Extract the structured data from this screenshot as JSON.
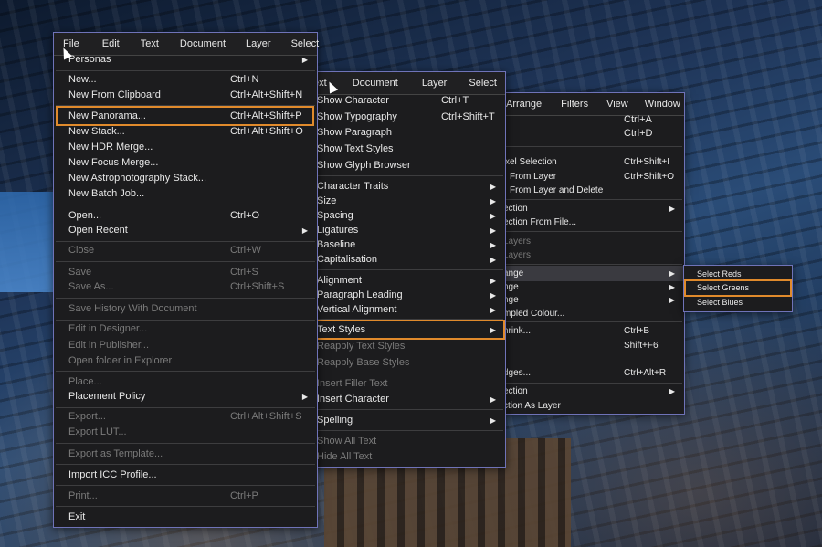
{
  "file_menu": {
    "menubar": [
      "File",
      "Edit",
      "Text",
      "Document",
      "Layer",
      "Select"
    ],
    "items": [
      {
        "label": "Personas",
        "shortcut": "",
        "submenu": true,
        "disabled": false
      },
      {
        "label": "New...",
        "shortcut": "Ctrl+N",
        "disabled": false
      },
      {
        "label": "New From Clipboard",
        "shortcut": "Ctrl+Alt+Shift+N",
        "disabled": false
      },
      {
        "label": "New Panorama...",
        "shortcut": "Ctrl+Alt+Shift+P",
        "disabled": false,
        "highlighted": true
      },
      {
        "label": "New Stack...",
        "shortcut": "Ctrl+Alt+Shift+O",
        "disabled": false
      },
      {
        "label": "New HDR Merge...",
        "shortcut": "",
        "disabled": false
      },
      {
        "label": "New Focus Merge...",
        "shortcut": "",
        "disabled": false
      },
      {
        "label": "New Astrophotography Stack...",
        "shortcut": "",
        "disabled": false
      },
      {
        "label": "New Batch Job...",
        "shortcut": "",
        "disabled": false
      },
      {
        "label": "Open...",
        "shortcut": "Ctrl+O",
        "disabled": false
      },
      {
        "label": "Open Recent",
        "shortcut": "",
        "submenu": true,
        "disabled": false
      },
      {
        "label": "Close",
        "shortcut": "Ctrl+W",
        "disabled": true
      },
      {
        "label": "Save",
        "shortcut": "Ctrl+S",
        "disabled": true
      },
      {
        "label": "Save As...",
        "shortcut": "Ctrl+Shift+S",
        "disabled": true
      },
      {
        "label": "Save History With Document",
        "shortcut": "",
        "disabled": true
      },
      {
        "label": "Edit in Designer...",
        "shortcut": "",
        "disabled": true
      },
      {
        "label": "Edit in Publisher...",
        "shortcut": "",
        "disabled": true
      },
      {
        "label": "Open folder in Explorer",
        "shortcut": "",
        "disabled": true
      },
      {
        "label": "Place...",
        "shortcut": "",
        "disabled": true
      },
      {
        "label": "Placement Policy",
        "shortcut": "",
        "submenu": true,
        "disabled": false
      },
      {
        "label": "Export...",
        "shortcut": "Ctrl+Alt+Shift+S",
        "disabled": true
      },
      {
        "label": "Export LUT...",
        "shortcut": "",
        "disabled": true
      },
      {
        "label": "Export as Template...",
        "shortcut": "",
        "disabled": true
      },
      {
        "label": "Import ICC Profile...",
        "shortcut": "",
        "disabled": false
      },
      {
        "label": "Print...",
        "shortcut": "Ctrl+P",
        "disabled": true
      },
      {
        "label": "Exit",
        "shortcut": "",
        "disabled": false
      }
    ]
  },
  "text_menu": {
    "menubar": [
      "ext",
      "Document",
      "Layer",
      "Select"
    ],
    "items": [
      {
        "label": "Show Character",
        "shortcut": "Ctrl+T",
        "disabled": false
      },
      {
        "label": "Show Typography",
        "shortcut": "Ctrl+Shift+T",
        "disabled": false
      },
      {
        "label": "Show Paragraph",
        "shortcut": "",
        "disabled": false
      },
      {
        "label": "Show Text Styles",
        "shortcut": "",
        "disabled": false
      },
      {
        "label": "Show Glyph Browser",
        "shortcut": "",
        "disabled": false
      },
      {
        "label": "Character Traits",
        "submenu": true,
        "disabled": false
      },
      {
        "label": "Size",
        "submenu": true,
        "disabled": false
      },
      {
        "label": "Spacing",
        "submenu": true,
        "disabled": false
      },
      {
        "label": "Ligatures",
        "submenu": true,
        "disabled": false
      },
      {
        "label": "Baseline",
        "submenu": true,
        "disabled": false
      },
      {
        "label": "Capitalisation",
        "submenu": true,
        "disabled": false
      },
      {
        "label": "Alignment",
        "submenu": true,
        "disabled": false
      },
      {
        "label": "Paragraph Leading",
        "submenu": true,
        "disabled": false
      },
      {
        "label": "Vertical Alignment",
        "submenu": true,
        "disabled": false
      },
      {
        "label": "Text Styles",
        "submenu": true,
        "disabled": false,
        "highlighted": true
      },
      {
        "label": "Reapply Text Styles",
        "disabled": true
      },
      {
        "label": "Reapply Base Styles",
        "disabled": true
      },
      {
        "label": "Insert Filler Text",
        "disabled": true
      },
      {
        "label": "Insert Character",
        "submenu": true,
        "disabled": false
      },
      {
        "label": "Spelling",
        "submenu": true,
        "disabled": false
      },
      {
        "label": "Show All Text",
        "disabled": true
      },
      {
        "label": "Hide All Text",
        "disabled": true
      }
    ]
  },
  "select_menu": {
    "menubar": [
      "Arrange",
      "Filters",
      "View",
      "Window"
    ],
    "items": [
      {
        "label": "",
        "shortcut": "Ctrl+A"
      },
      {
        "label": "",
        "shortcut": "Ctrl+D"
      },
      {
        "label": "xel Selection",
        "shortcut": "Ctrl+Shift+I"
      },
      {
        "label": "From Layer",
        "shortcut": "Ctrl+Shift+O"
      },
      {
        "label": "From Layer and Delete",
        "shortcut": ""
      },
      {
        "label": "ection",
        "shortcut": "",
        "submenu": true
      },
      {
        "label": "ection From File...",
        "shortcut": ""
      },
      {
        "label": "Layers",
        "shortcut": "",
        "disabled": true
      },
      {
        "label": "Layers",
        "shortcut": "",
        "disabled": true
      },
      {
        "label": "ange",
        "shortcut": "",
        "submenu": true,
        "highlighted": true
      },
      {
        "label": "nge",
        "shortcut": "",
        "submenu": true
      },
      {
        "label": "nge",
        "shortcut": "",
        "submenu": true
      },
      {
        "label": "mpled Colour...",
        "shortcut": ""
      },
      {
        "label": "hrink...",
        "shortcut": "Ctrl+B"
      },
      {
        "label": "",
        "shortcut": "Shift+F6"
      },
      {
        "label": ".",
        "shortcut": ""
      },
      {
        "label": "dges...",
        "shortcut": "Ctrl+Alt+R"
      },
      {
        "label": "ection",
        "shortcut": "",
        "submenu": true
      },
      {
        "label": "ction As Layer",
        "shortcut": ""
      }
    ]
  },
  "range_submenu": {
    "items": [
      "Select Reds",
      "Select Greens",
      "Select Blues"
    ]
  }
}
